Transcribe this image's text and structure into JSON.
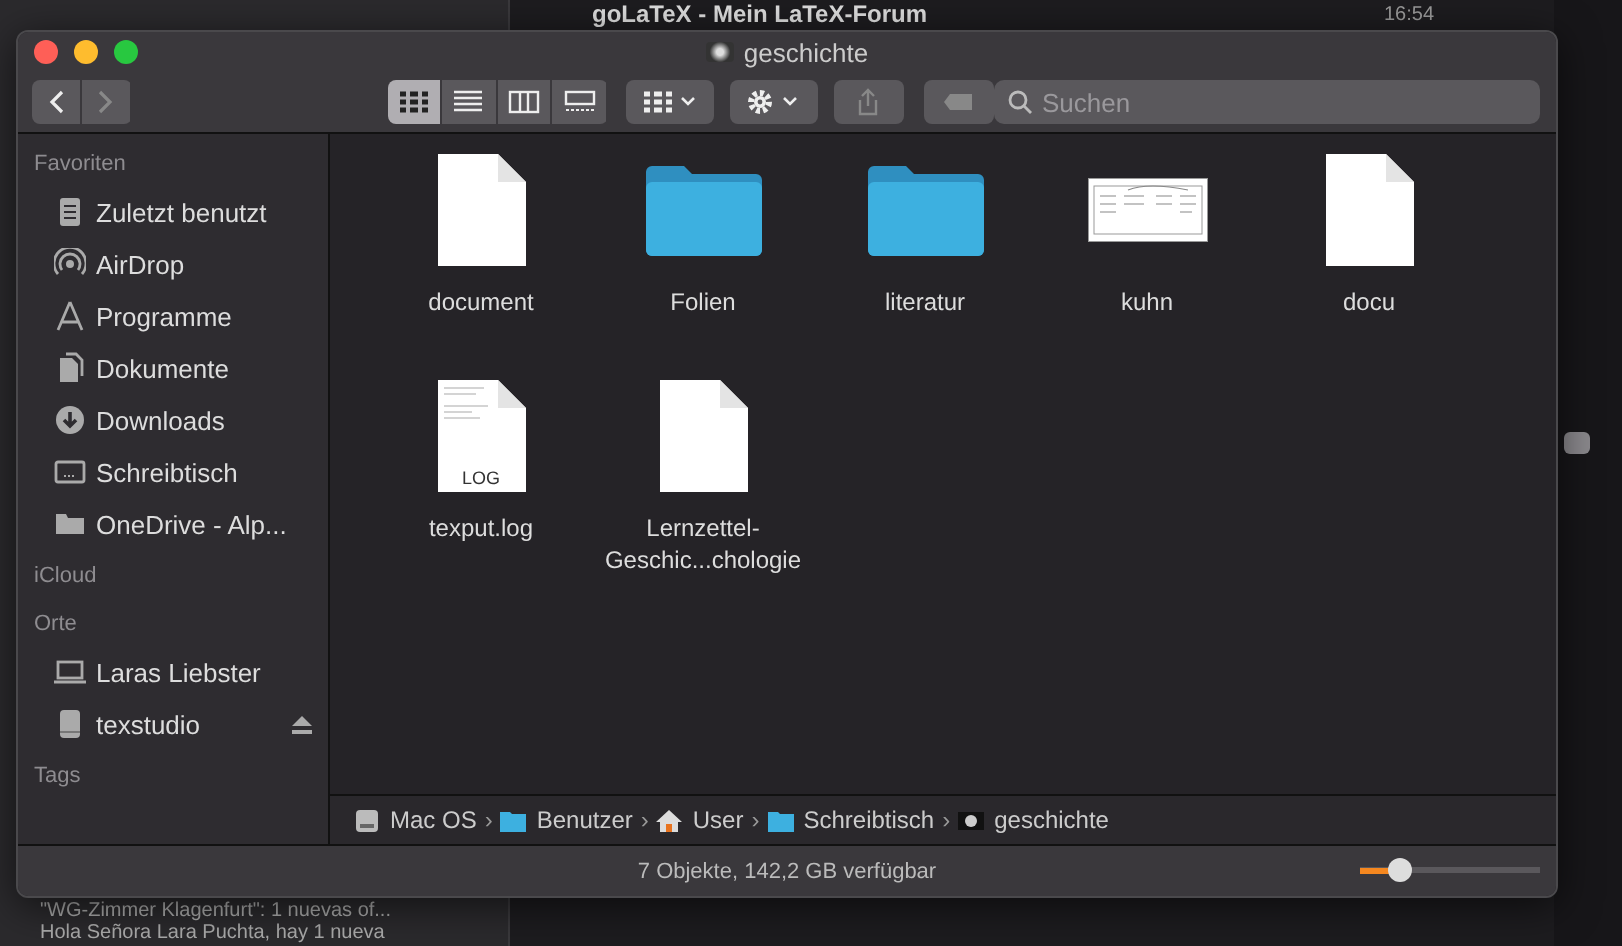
{
  "background_app": {
    "title": "goLaTeX - Mein LaTeX-Forum",
    "time": "16:54",
    "messages": [
      "\"WG-Zimmer Klagenfurt\": 1 nuevas of...",
      "Hola Señora Lara Puchta, hay 1 nueva"
    ]
  },
  "window": {
    "title": "geschichte"
  },
  "toolbar": {
    "views": [
      {
        "kind": "icons",
        "selected": true
      },
      {
        "kind": "list",
        "selected": false
      },
      {
        "kind": "columns",
        "selected": false
      },
      {
        "kind": "gallery",
        "selected": false
      }
    ],
    "search": {
      "placeholder": "Suchen"
    }
  },
  "sidebar": {
    "sections": [
      {
        "title": "Favoriten",
        "items": [
          {
            "label": "Zuletzt benutzt",
            "kind": "recents"
          },
          {
            "label": "AirDrop",
            "kind": "airdrop"
          },
          {
            "label": "Programme",
            "kind": "apps"
          },
          {
            "label": "Dokumente",
            "kind": "docs"
          },
          {
            "label": "Downloads",
            "kind": "downloads"
          },
          {
            "label": "Schreibtisch",
            "kind": "desktop"
          },
          {
            "label": "OneDrive - Alp...",
            "kind": "folder"
          }
        ]
      },
      {
        "title": "iCloud"
      },
      {
        "title": "Orte",
        "items": [
          {
            "label": "Laras Liebster",
            "kind": "computer"
          },
          {
            "label": "texstudio",
            "kind": "disk",
            "ejectable": true
          }
        ]
      },
      {
        "title": "Tags"
      }
    ]
  },
  "files": [
    {
      "name": "document",
      "kind": "document"
    },
    {
      "name": "Folien",
      "kind": "folder"
    },
    {
      "name": "literatur",
      "kind": "folder"
    },
    {
      "name": "kuhn",
      "kind": "thumbnail"
    },
    {
      "name": "docu",
      "kind": "document"
    },
    {
      "name": "texput.log",
      "kind": "log",
      "badge": "LOG"
    },
    {
      "name": "Lernzettel-\nGeschic...chologie",
      "kind": "document"
    }
  ],
  "path_bar": [
    {
      "label": "Mac OS",
      "kind": "disk"
    },
    {
      "separator": "›",
      "label": "Benutzer",
      "kind": "folder"
    },
    {
      "separator": "›",
      "label": "User",
      "kind": "home"
    },
    {
      "separator": "›",
      "label": "Schreibtisch",
      "kind": "folder"
    },
    {
      "separator": "›",
      "label": "geschichte",
      "kind": "image"
    }
  ],
  "status_bar": {
    "text": "7 Objekte, 142,2 GB verfügbar",
    "icon_size": {
      "level": 0.22
    }
  }
}
